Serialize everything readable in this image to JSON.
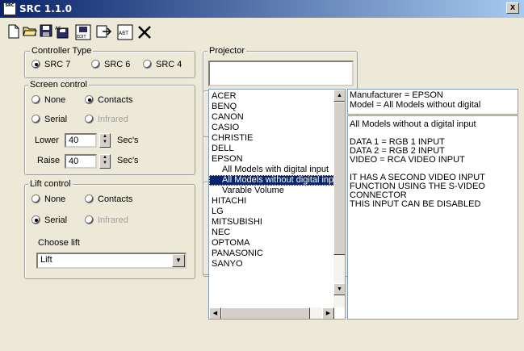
{
  "window": {
    "title": "SRC 1.1.0",
    "icon_text": "SRC",
    "close_label": "x"
  },
  "toolbar": {
    "buttons": [
      {
        "name": "new-file-icon"
      },
      {
        "name": "open-folder-icon"
      },
      {
        "name": "save-icon"
      },
      {
        "name": "save-as-icon",
        "label": "AS"
      },
      {
        "name": "edit-icon",
        "label": "EDIT"
      },
      {
        "name": "export-icon"
      },
      {
        "name": "about-icon",
        "label": "ABT"
      },
      {
        "name": "close-x-icon",
        "label": "✕"
      }
    ]
  },
  "controller_type": {
    "legend": "Controller Type",
    "options": [
      "SRC 7",
      "SRC 6",
      "SRC 4"
    ],
    "selected": "SRC 7"
  },
  "screen_control": {
    "legend": "Screen control",
    "none": "None",
    "contacts": "Contacts",
    "serial": "Serial",
    "infrared": "Infrared",
    "selected": "Contacts",
    "lower_label": "Lower",
    "lower_value": "40",
    "raise_label": "Raise",
    "raise_value": "40",
    "unit": "Sec's"
  },
  "lift_control": {
    "legend": "Lift control",
    "none": "None",
    "contacts": "Contacts",
    "serial": "Serial",
    "infrared": "Infrared",
    "selected": "Serial",
    "choose_label": "Choose lift",
    "choose_value": "Lift"
  },
  "projector": {
    "legend": "Projector",
    "list": [
      {
        "label": "ACER",
        "indent": false
      },
      {
        "label": "BENQ",
        "indent": false
      },
      {
        "label": "CANON",
        "indent": false
      },
      {
        "label": "CASIO",
        "indent": false
      },
      {
        "label": "CHRISTIE",
        "indent": false
      },
      {
        "label": "DELL",
        "indent": false
      },
      {
        "label": "EPSON",
        "indent": false
      },
      {
        "label": "All Models with digital input",
        "indent": true
      },
      {
        "label": "All Models without digital input",
        "indent": true,
        "selected": true
      },
      {
        "label": "Varable Volume",
        "indent": true
      },
      {
        "label": "HITACHI",
        "indent": false
      },
      {
        "label": "LG",
        "indent": false
      },
      {
        "label": "MITSUBISHI",
        "indent": false
      },
      {
        "label": "NEC",
        "indent": false
      },
      {
        "label": "OPTOMA",
        "indent": false
      },
      {
        "label": "PANASONIC",
        "indent": false
      },
      {
        "label": "SANYO",
        "indent": false
      }
    ],
    "header_line1": "Manufacturer = EPSON",
    "header_line2": "Model = All Models without digital",
    "description": "All Models without a digital input\n\nDATA 1 = RGB 1 INPUT\nDATA 2 = RGB 2 INPUT\nVIDEO = RCA VIDEO INPUT\n\nIT HAS A SECOND VIDEO INPUT\nFUNCTION USING THE S-VIDEO\nCONNECTOR\nTHIS INPUT CAN BE DISABLED"
  }
}
